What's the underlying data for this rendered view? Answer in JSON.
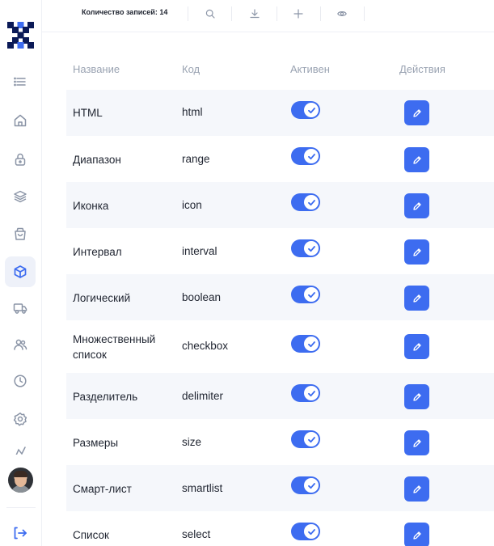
{
  "toolbar": {
    "records_count_label": "Количество записей: 14",
    "icons": [
      "search-icon",
      "download-icon",
      "plus-icon",
      "eye-icon"
    ]
  },
  "sidebar": {
    "items": [
      {
        "icon": "menu-icon"
      },
      {
        "icon": "home-icon"
      },
      {
        "icon": "lock-icon"
      },
      {
        "icon": "layers-icon"
      },
      {
        "icon": "shopping-bag-icon"
      },
      {
        "icon": "cube-icon",
        "active": true
      },
      {
        "icon": "truck-icon"
      },
      {
        "icon": "users-icon"
      },
      {
        "icon": "clock-icon"
      },
      {
        "icon": "settings-icon"
      },
      {
        "icon": "chart-icon"
      }
    ],
    "bottom": {
      "icon": "logout-icon"
    }
  },
  "table": {
    "headers": {
      "name": "Название",
      "code": "Код",
      "active": "Активен",
      "actions": "Действия"
    },
    "rows": [
      {
        "name": "HTML",
        "code": "html",
        "active": true
      },
      {
        "name": "Диапазон",
        "code": "range",
        "active": true
      },
      {
        "name": "Иконка",
        "code": "icon",
        "active": true
      },
      {
        "name": "Интервал",
        "code": "interval",
        "active": true
      },
      {
        "name": "Логический",
        "code": "boolean",
        "active": true
      },
      {
        "name": "Множественный список",
        "name_lines": [
          "Множественный",
          "список"
        ],
        "code": "checkbox",
        "active": true
      },
      {
        "name": "Разделитель",
        "code": "delimiter",
        "active": true
      },
      {
        "name": "Размеры",
        "code": "size",
        "active": true
      },
      {
        "name": "Смарт-лист",
        "code": "smartlist",
        "active": true
      },
      {
        "name": "Список",
        "code": "select",
        "active": true
      }
    ]
  },
  "colors": {
    "accent": "#3d6cf0",
    "row_stripe": "#f5f7fb",
    "header_text": "#9aa3b2",
    "icon_gray": "#8a94a6"
  }
}
